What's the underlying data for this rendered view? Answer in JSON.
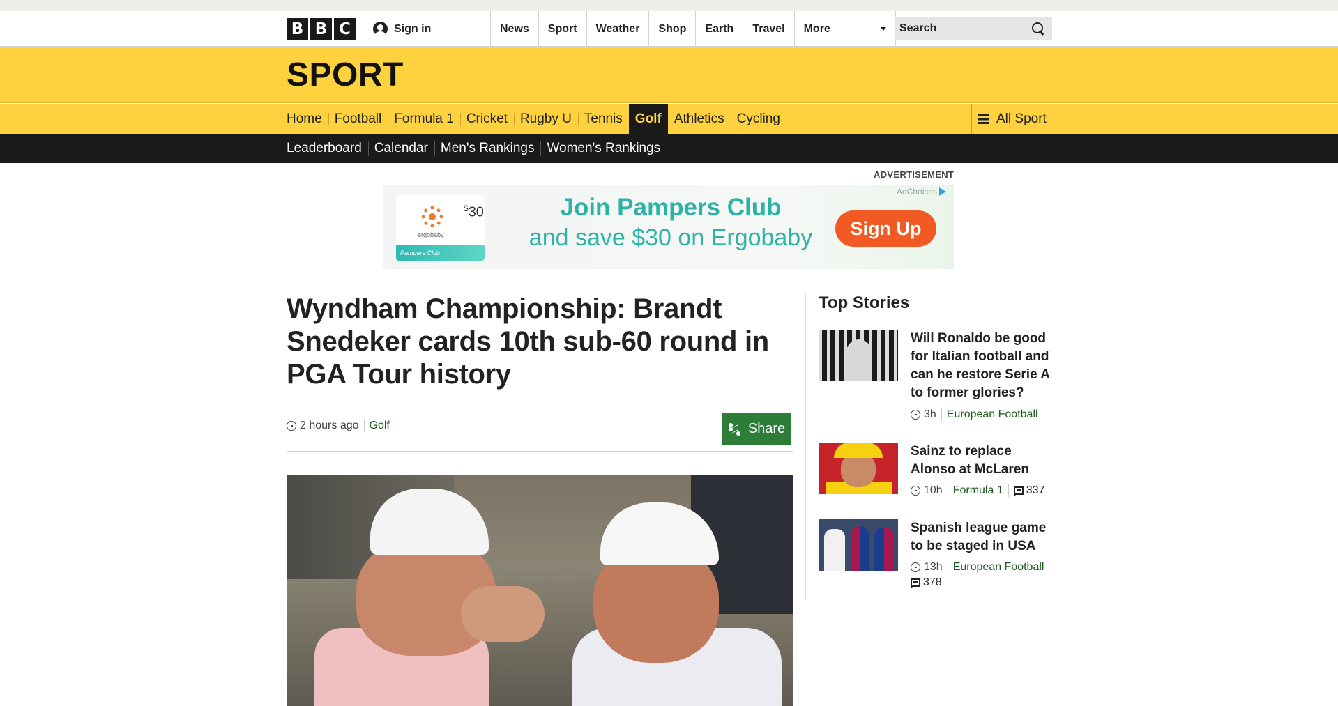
{
  "global_nav": {
    "logo_letters": [
      "B",
      "B",
      "C"
    ],
    "signin_label": "Sign in",
    "links": [
      "News",
      "Sport",
      "Weather",
      "Shop",
      "Earth",
      "Travel"
    ],
    "more_label": "More",
    "search_placeholder": "Search"
  },
  "sport_header": {
    "title": "SPORT",
    "tabs": [
      "Home",
      "Football",
      "Formula 1",
      "Cricket",
      "Rugby U",
      "Tennis",
      "Golf",
      "Athletics",
      "Cycling"
    ],
    "active_tab": "Golf",
    "all_sport_label": "All Sport",
    "sub_tabs": [
      "Leaderboard",
      "Calendar",
      "Men's Rankings",
      "Women's Rankings"
    ]
  },
  "advertisement": {
    "label": "ADVERTISEMENT",
    "adchoices_label": "AdChoices",
    "price": "30",
    "price_symbol": "$",
    "product_brand": "ergobaby",
    "card_text": "Pampers Club",
    "headline": "Join Pampers Club",
    "subline": "and save $30 on Ergobaby",
    "cta": "Sign Up"
  },
  "article": {
    "headline": "Wyndham Championship: Brandt Snedeker cards 10th sub-60 round in PGA Tour history",
    "timestamp": "2 hours ago",
    "topic": "Golf",
    "share_label": "Share"
  },
  "sidebar": {
    "title": "Top Stories",
    "stories": [
      {
        "title": "Will Ronaldo be good for Italian football and can he restore Serie A to former glories?",
        "time": "3h",
        "topic": "European Football",
        "comments": ""
      },
      {
        "title": "Sainz to replace Alonso at McLaren",
        "time": "10h",
        "topic": "Formula 1",
        "comments": "337"
      },
      {
        "title": "Spanish league game to be staged in USA",
        "time": "13h",
        "topic": "European Football",
        "comments": "378"
      }
    ]
  },
  "colors": {
    "sport_yellow": "#fed13e",
    "nav_dark": "#1a1a1a",
    "share_green": "#2b7d37",
    "topic_green": "#1a5c1a",
    "ad_teal": "#2bb3a8",
    "ad_orange": "#f15a22"
  }
}
